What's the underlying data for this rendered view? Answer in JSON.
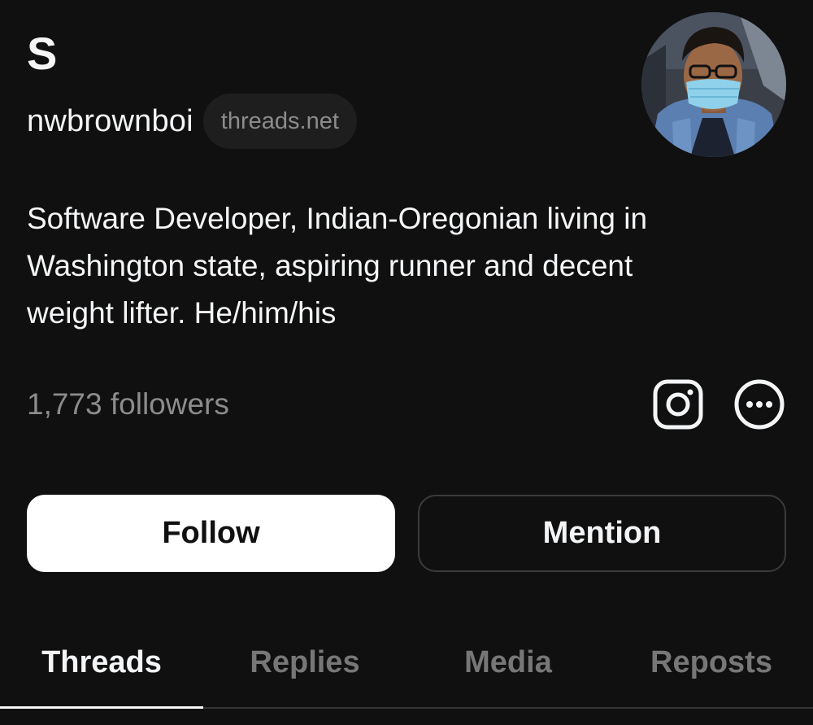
{
  "profile": {
    "display_name": "S",
    "username": "nwbrownboi",
    "domain_chip": "threads.net",
    "bio_lines": [
      "Software Developer, Indian-Oregonian living in",
      "Washington state, aspiring runner and decent",
      "weight lifter. He/him/his"
    ],
    "followers": "1,773 followers",
    "avatar": "profile-photo"
  },
  "actions": {
    "instagram_icon": "instagram-icon",
    "more_icon": "more-options-icon",
    "follow_label": "Follow",
    "mention_label": "Mention"
  },
  "tabs": [
    {
      "label": "Threads",
      "active": true
    },
    {
      "label": "Replies",
      "active": false
    },
    {
      "label": "Media",
      "active": false
    },
    {
      "label": "Reposts",
      "active": false
    }
  ],
  "colors": {
    "background": "#101010",
    "primary_text": "#f3f5f7",
    "secondary_text": "#8c8c8c",
    "follow_button_bg": "#ffffff",
    "inactive_tab": "#777777"
  }
}
